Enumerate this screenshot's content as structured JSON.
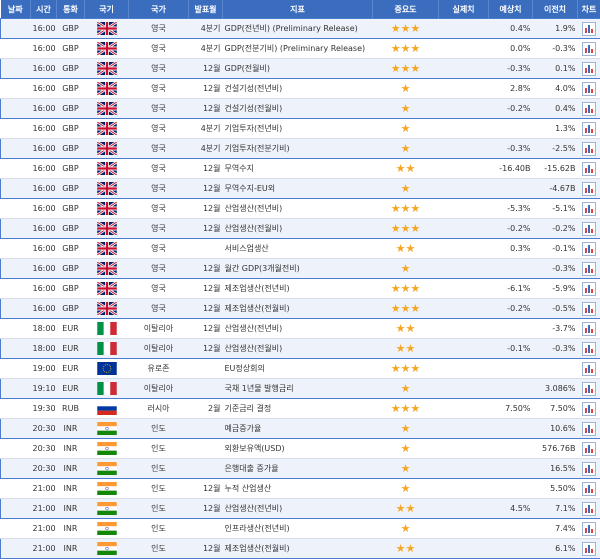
{
  "headers": [
    "날짜",
    "시간",
    "통화",
    "국기",
    "국가",
    "발표월",
    "지표",
    "중요도",
    "실제치",
    "예상치",
    "이전치",
    "차트"
  ],
  "colors": {
    "header": "#3b6dbf",
    "row_alt": "#eef3fb",
    "star": "#f5a623"
  },
  "rows": [
    {
      "time": "16:00",
      "cur": "GBP",
      "flag": "uk",
      "country": "영국",
      "month": "4분기",
      "ind": "GDP(전년비) (Preliminary Release)",
      "stars": 3,
      "actual": "",
      "forecast": "0.4%",
      "prev": "1.9%"
    },
    {
      "time": "16:00",
      "cur": "GBP",
      "flag": "uk",
      "country": "영국",
      "month": "4분기",
      "ind": "GDP(전분기비) (Preliminary Release)",
      "stars": 3,
      "actual": "",
      "forecast": "0.0%",
      "prev": "-0.3%"
    },
    {
      "time": "16:00",
      "cur": "GBP",
      "flag": "uk",
      "country": "영국",
      "month": "12월",
      "ind": "GDP(전월비)",
      "stars": 3,
      "actual": "",
      "forecast": "-0.3%",
      "prev": "0.1%"
    },
    {
      "time": "16:00",
      "cur": "GBP",
      "flag": "uk",
      "country": "영국",
      "month": "12월",
      "ind": "건설기성(전년비)",
      "stars": 1,
      "actual": "",
      "forecast": "2.8%",
      "prev": "4.0%"
    },
    {
      "time": "16:00",
      "cur": "GBP",
      "flag": "uk",
      "country": "영국",
      "month": "12월",
      "ind": "건설기성(전월비)",
      "stars": 1,
      "actual": "",
      "forecast": "-0.2%",
      "prev": "0.4%"
    },
    {
      "time": "16:00",
      "cur": "GBP",
      "flag": "uk",
      "country": "영국",
      "month": "4분기",
      "ind": "기업투자(전년비)",
      "stars": 1,
      "actual": "",
      "forecast": "",
      "prev": "1.3%"
    },
    {
      "time": "16:00",
      "cur": "GBP",
      "flag": "uk",
      "country": "영국",
      "month": "4분기",
      "ind": "기업투자(전분기비)",
      "stars": 1,
      "actual": "",
      "forecast": "-0.3%",
      "prev": "-2.5%"
    },
    {
      "time": "16:00",
      "cur": "GBP",
      "flag": "uk",
      "country": "영국",
      "month": "12월",
      "ind": "무역수지",
      "stars": 2,
      "actual": "",
      "forecast": "-16.40B",
      "prev": "-15.62B"
    },
    {
      "time": "16:00",
      "cur": "GBP",
      "flag": "uk",
      "country": "영국",
      "month": "12월",
      "ind": "무역수지-EU외",
      "stars": 1,
      "actual": "",
      "forecast": "",
      "prev": "-4.67B"
    },
    {
      "time": "16:00",
      "cur": "GBP",
      "flag": "uk",
      "country": "영국",
      "month": "12월",
      "ind": "산업생산(전년비)",
      "stars": 3,
      "actual": "",
      "forecast": "-5.3%",
      "prev": "-5.1%"
    },
    {
      "time": "16:00",
      "cur": "GBP",
      "flag": "uk",
      "country": "영국",
      "month": "12월",
      "ind": "산업생산(전월비)",
      "stars": 3,
      "actual": "",
      "forecast": "-0.2%",
      "prev": "-0.2%"
    },
    {
      "time": "16:00",
      "cur": "GBP",
      "flag": "uk",
      "country": "영국",
      "month": "",
      "ind": "서비스업생산",
      "stars": 2,
      "actual": "",
      "forecast": "0.3%",
      "prev": "-0.1%"
    },
    {
      "time": "16:00",
      "cur": "GBP",
      "flag": "uk",
      "country": "영국",
      "month": "12월",
      "ind": "월간 GDP(3개월전비)",
      "stars": 1,
      "actual": "",
      "forecast": "",
      "prev": "-0.3%"
    },
    {
      "time": "16:00",
      "cur": "GBP",
      "flag": "uk",
      "country": "영국",
      "month": "12월",
      "ind": "제조업생산(전년비)",
      "stars": 3,
      "actual": "",
      "forecast": "-6.1%",
      "prev": "-5.9%"
    },
    {
      "time": "16:00",
      "cur": "GBP",
      "flag": "uk",
      "country": "영국",
      "month": "12월",
      "ind": "제조업생산(전월비)",
      "stars": 3,
      "actual": "",
      "forecast": "-0.2%",
      "prev": "-0.5%"
    },
    {
      "time": "18:00",
      "cur": "EUR",
      "flag": "it",
      "country": "이탈리아",
      "month": "12월",
      "ind": "산업생산(전년비)",
      "stars": 2,
      "actual": "",
      "forecast": "",
      "prev": "-3.7%"
    },
    {
      "time": "18:00",
      "cur": "EUR",
      "flag": "it",
      "country": "이탈리아",
      "month": "12월",
      "ind": "산업생산(전월비)",
      "stars": 2,
      "actual": "",
      "forecast": "-0.1%",
      "prev": "-0.3%"
    },
    {
      "time": "19:00",
      "cur": "EUR",
      "flag": "eu",
      "country": "유로존",
      "month": "",
      "ind": "EU정상회의",
      "stars": 3,
      "actual": "",
      "forecast": "",
      "prev": ""
    },
    {
      "time": "19:10",
      "cur": "EUR",
      "flag": "it",
      "country": "이탈리아",
      "month": "",
      "ind": "국채 1년물 발행금리",
      "stars": 1,
      "actual": "",
      "forecast": "",
      "prev": "3.086%"
    },
    {
      "time": "19:30",
      "cur": "RUB",
      "flag": "ru",
      "country": "러시아",
      "month": "2월",
      "ind": "기준금리 결정",
      "stars": 3,
      "actual": "",
      "forecast": "7.50%",
      "prev": "7.50%"
    },
    {
      "time": "20:30",
      "cur": "INR",
      "flag": "in",
      "country": "인도",
      "month": "",
      "ind": "예금증가율",
      "stars": 1,
      "actual": "",
      "forecast": "",
      "prev": "10.6%"
    },
    {
      "time": "20:30",
      "cur": "INR",
      "flag": "in",
      "country": "인도",
      "month": "",
      "ind": "외환보유액(USD)",
      "stars": 1,
      "actual": "",
      "forecast": "",
      "prev": "576.76B"
    },
    {
      "time": "20:30",
      "cur": "INR",
      "flag": "in",
      "country": "인도",
      "month": "",
      "ind": "은행대출 증가율",
      "stars": 1,
      "actual": "",
      "forecast": "",
      "prev": "16.5%"
    },
    {
      "time": "21:00",
      "cur": "INR",
      "flag": "in",
      "country": "인도",
      "month": "12월",
      "ind": "누적 산업생산",
      "stars": 1,
      "actual": "",
      "forecast": "",
      "prev": "5.50%"
    },
    {
      "time": "21:00",
      "cur": "INR",
      "flag": "in",
      "country": "인도",
      "month": "12월",
      "ind": "산업생산(전년비)",
      "stars": 2,
      "actual": "",
      "forecast": "4.5%",
      "prev": "7.1%"
    },
    {
      "time": "21:00",
      "cur": "INR",
      "flag": "in",
      "country": "인도",
      "month": "",
      "ind": "인프라생산(전년비)",
      "stars": 1,
      "actual": "",
      "forecast": "",
      "prev": "7.4%"
    },
    {
      "time": "21:00",
      "cur": "INR",
      "flag": "in",
      "country": "인도",
      "month": "12월",
      "ind": "제조업생산(전월비)",
      "stars": 2,
      "actual": "",
      "forecast": "",
      "prev": "6.1%"
    }
  ]
}
